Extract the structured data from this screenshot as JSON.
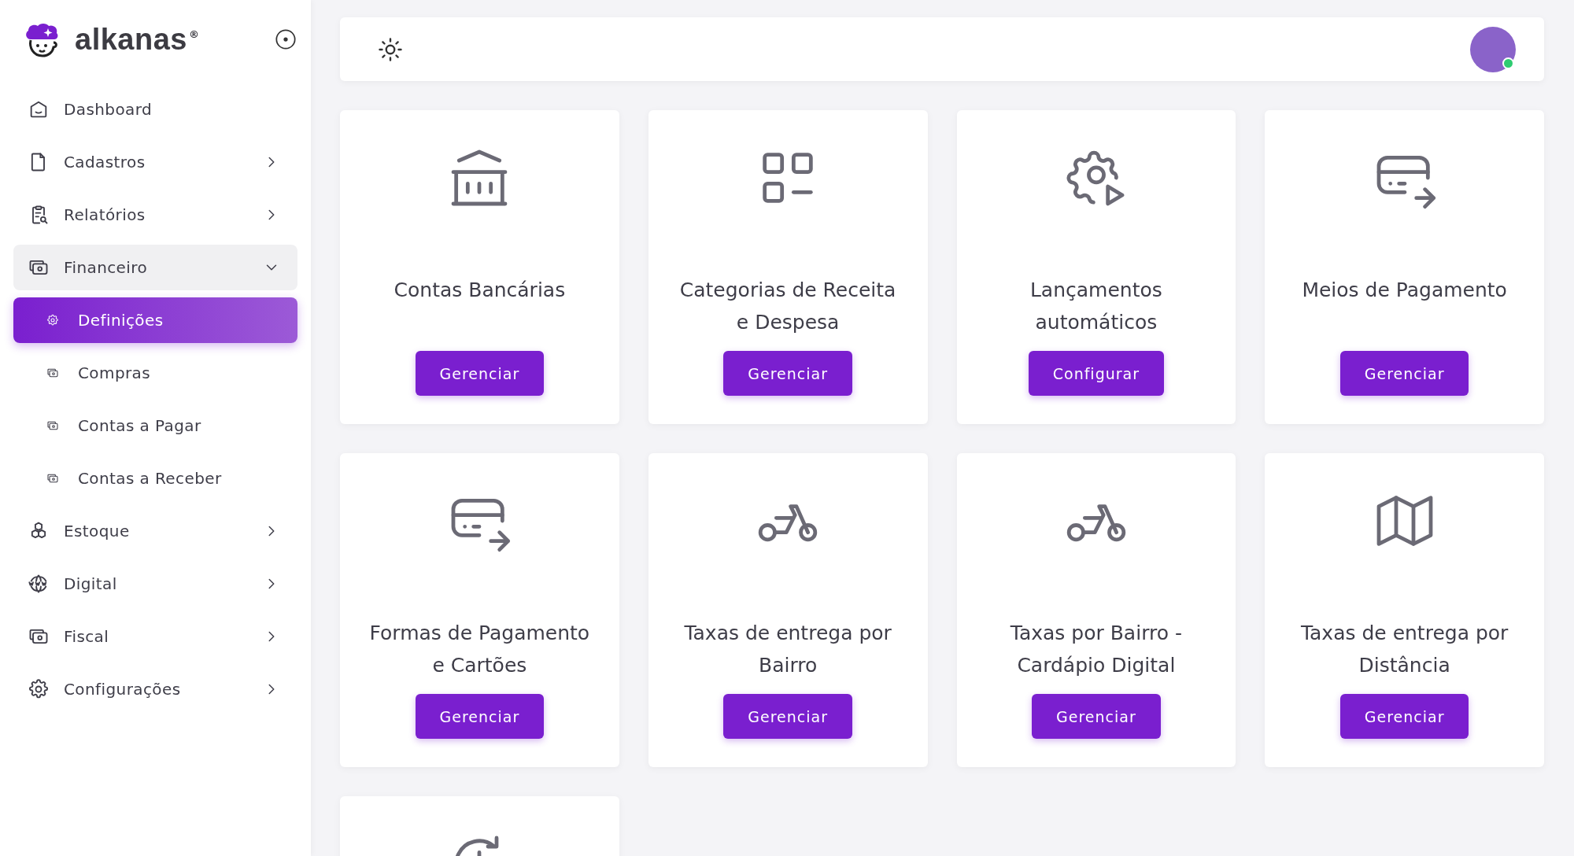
{
  "brand": {
    "name": "alkanas",
    "mark": "®"
  },
  "sidebar": {
    "items": [
      {
        "label": "Dashboard",
        "has_children": false,
        "expanded": false,
        "selected": false
      },
      {
        "label": "Cadastros",
        "has_children": true,
        "expanded": false,
        "selected": false
      },
      {
        "label": "Relatórios",
        "has_children": true,
        "expanded": false,
        "selected": false
      },
      {
        "label": "Financeiro",
        "has_children": true,
        "expanded": true,
        "selected": false,
        "children": [
          {
            "label": "Definições",
            "selected": true
          },
          {
            "label": "Compras",
            "selected": false
          },
          {
            "label": "Contas a Pagar",
            "selected": false
          },
          {
            "label": "Contas a Receber",
            "selected": false
          }
        ]
      },
      {
        "label": "Estoque",
        "has_children": true,
        "expanded": false,
        "selected": false
      },
      {
        "label": "Digital",
        "has_children": true,
        "expanded": false,
        "selected": false
      },
      {
        "label": "Fiscal",
        "has_children": true,
        "expanded": false,
        "selected": false
      },
      {
        "label": "Configurações",
        "has_children": true,
        "expanded": false,
        "selected": false
      }
    ]
  },
  "topbar": {
    "avatar": {
      "online": true
    }
  },
  "cards": [
    {
      "title": "Contas Bancárias",
      "button": "Gerenciar"
    },
    {
      "title": "Categorias de Receita e Despesa",
      "button": "Gerenciar"
    },
    {
      "title": "Lançamentos automáticos",
      "button": "Configurar"
    },
    {
      "title": "Meios de Pagamento",
      "button": "Gerenciar"
    },
    {
      "title": "Formas de Pagamento e Cartões",
      "button": "Gerenciar"
    },
    {
      "title": "Taxas de entrega por Bairro",
      "button": "Gerenciar"
    },
    {
      "title": "Taxas por Bairro - Cardápio Digital",
      "button": "Gerenciar"
    },
    {
      "title": "Taxas de entrega por Distância",
      "button": "Gerenciar"
    }
  ],
  "more_cards_below": true
}
